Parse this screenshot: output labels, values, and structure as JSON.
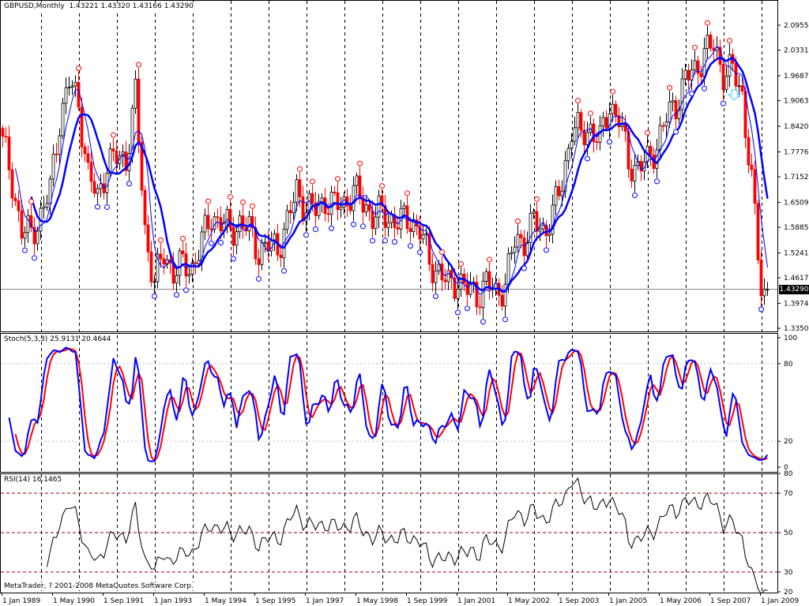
{
  "header": {
    "symbol_period": "GBPUSD,Monthly",
    "open": "1.43221",
    "high": "1.43320",
    "low": "1.43166",
    "close": "1.43290"
  },
  "stoch": {
    "label": "Stoch(5,3,3)",
    "main": "25.9131",
    "signal": "20.4644",
    "levels": [
      "100",
      "80",
      "20",
      "0"
    ],
    "main_color": "#0000ff",
    "signal_color": "#ff0000"
  },
  "rsi": {
    "label": "RSI(14)",
    "value": "16.1465",
    "levels": [
      "80",
      "70",
      "50",
      "30",
      "20"
    ],
    "color": "#000000"
  },
  "copyright": "MetaTrader, ? 2001-2008 MetaQuotes Software Corp.",
  "current_price": "1.43290",
  "chart_data": {
    "type": "candlestick",
    "symbol": "GBPUSD",
    "period": "Monthly",
    "y_ticks": [
      "2.09550",
      "2.03310",
      "1.96875",
      "1.90635",
      "1.84200",
      "1.77765",
      "1.71525",
      "1.65090",
      "1.58850",
      "1.52415",
      "1.46175",
      "1.39740",
      "1.33500"
    ],
    "ylim": [
      1.335,
      2.0955
    ],
    "x_ticks": [
      "1 Jan 1989",
      "1 May 1990",
      "1 Sep 1991",
      "1 Jan 1993",
      "1 May 1994",
      "1 Sep 1995",
      "1 Jan 1997",
      "1 May 1998",
      "1 Sep 1999",
      "1 Jan 2001",
      "1 May 2002",
      "1 Sep 2003",
      "1 Jan 2005",
      "1 May 2006",
      "1 Sep 2007",
      "1 Jan 2009"
    ],
    "quarterly_close": {
      "start": "Jan 1989",
      "values": [
        1.8,
        1.7,
        1.58,
        1.57,
        1.62,
        1.68,
        1.86,
        1.95,
        1.9,
        1.72,
        1.66,
        1.75,
        1.76,
        1.76,
        1.92,
        1.58,
        1.45,
        1.52,
        1.48,
        1.49,
        1.49,
        1.55,
        1.62,
        1.6,
        1.58,
        1.6,
        1.58,
        1.53,
        1.54,
        1.54,
        1.6,
        1.68,
        1.64,
        1.63,
        1.66,
        1.64,
        1.65,
        1.68,
        1.65,
        1.62,
        1.62,
        1.61,
        1.6,
        1.61,
        1.58,
        1.5,
        1.48,
        1.44,
        1.46,
        1.43,
        1.42,
        1.45,
        1.42,
        1.45,
        1.55,
        1.56,
        1.6,
        1.58,
        1.62,
        1.7,
        1.84,
        1.82,
        1.84,
        1.8,
        1.9,
        1.86,
        1.75,
        1.74,
        1.75,
        1.8,
        1.86,
        1.9,
        1.96,
        1.98,
        2.03,
        2.04,
        1.98,
        1.98,
        1.92,
        1.7,
        1.43
      ]
    },
    "last_close": 1.4329,
    "up_color": "#ffffff",
    "down_color": "#ff0000",
    "ma_color": "#0000ff",
    "fractal_up_color": "#ff0000",
    "fractal_down_color": "#0000ff",
    "grid": true
  }
}
